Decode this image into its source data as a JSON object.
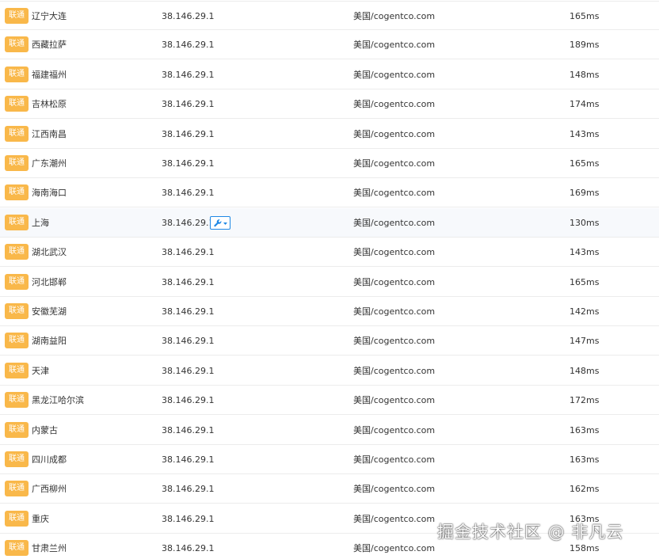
{
  "colors": {
    "badge": "#f9b84a",
    "tool_button": "#1e88e5",
    "row_hover": "#f7f9fc"
  },
  "rows": [
    {
      "isp_badge": "联通",
      "location": "辽宁大连",
      "ip": "38.146.29.1",
      "geo": "美国/cogentco.com",
      "latency": "165ms"
    },
    {
      "isp_badge": "联通",
      "location": "西藏拉萨",
      "ip": "38.146.29.1",
      "geo": "美国/cogentco.com",
      "latency": "189ms"
    },
    {
      "isp_badge": "联通",
      "location": "福建福州",
      "ip": "38.146.29.1",
      "geo": "美国/cogentco.com",
      "latency": "148ms"
    },
    {
      "isp_badge": "联通",
      "location": "吉林松原",
      "ip": "38.146.29.1",
      "geo": "美国/cogentco.com",
      "latency": "174ms"
    },
    {
      "isp_badge": "联通",
      "location": "江西南昌",
      "ip": "38.146.29.1",
      "geo": "美国/cogentco.com",
      "latency": "143ms"
    },
    {
      "isp_badge": "联通",
      "location": "广东潮州",
      "ip": "38.146.29.1",
      "geo": "美国/cogentco.com",
      "latency": "165ms"
    },
    {
      "isp_badge": "联通",
      "location": "海南海口",
      "ip": "38.146.29.1",
      "geo": "美国/cogentco.com",
      "latency": "169ms"
    },
    {
      "isp_badge": "联通",
      "location": "上海",
      "ip": "38.146.29.1",
      "geo": "美国/cogentco.com",
      "latency": "130ms",
      "hovered": true
    },
    {
      "isp_badge": "联通",
      "location": "湖北武汉",
      "ip": "38.146.29.1",
      "geo": "美国/cogentco.com",
      "latency": "143ms"
    },
    {
      "isp_badge": "联通",
      "location": "河北邯郸",
      "ip": "38.146.29.1",
      "geo": "美国/cogentco.com",
      "latency": "165ms"
    },
    {
      "isp_badge": "联通",
      "location": "安徽芜湖",
      "ip": "38.146.29.1",
      "geo": "美国/cogentco.com",
      "latency": "142ms"
    },
    {
      "isp_badge": "联通",
      "location": "湖南益阳",
      "ip": "38.146.29.1",
      "geo": "美国/cogentco.com",
      "latency": "147ms"
    },
    {
      "isp_badge": "联通",
      "location": "天津",
      "ip": "38.146.29.1",
      "geo": "美国/cogentco.com",
      "latency": "148ms"
    },
    {
      "isp_badge": "联通",
      "location": "黑龙江哈尔滨",
      "ip": "38.146.29.1",
      "geo": "美国/cogentco.com",
      "latency": "172ms"
    },
    {
      "isp_badge": "联通",
      "location": "内蒙古",
      "ip": "38.146.29.1",
      "geo": "美国/cogentco.com",
      "latency": "163ms"
    },
    {
      "isp_badge": "联通",
      "location": "四川成都",
      "ip": "38.146.29.1",
      "geo": "美国/cogentco.com",
      "latency": "163ms"
    },
    {
      "isp_badge": "联通",
      "location": "广西柳州",
      "ip": "38.146.29.1",
      "geo": "美国/cogentco.com",
      "latency": "162ms"
    },
    {
      "isp_badge": "联通",
      "location": "重庆",
      "ip": "38.146.29.1",
      "geo": "美国/cogentco.com",
      "latency": "163ms"
    },
    {
      "isp_badge": "联通",
      "location": "甘肃兰州",
      "ip": "38.146.29.1",
      "geo": "美国/cogentco.com",
      "latency": "158ms"
    }
  ],
  "tool_button": {
    "icon": "wrench-icon",
    "dropdown_icon": "caret-down-icon"
  },
  "watermark": "掘金技术社区 @ 非凡云"
}
